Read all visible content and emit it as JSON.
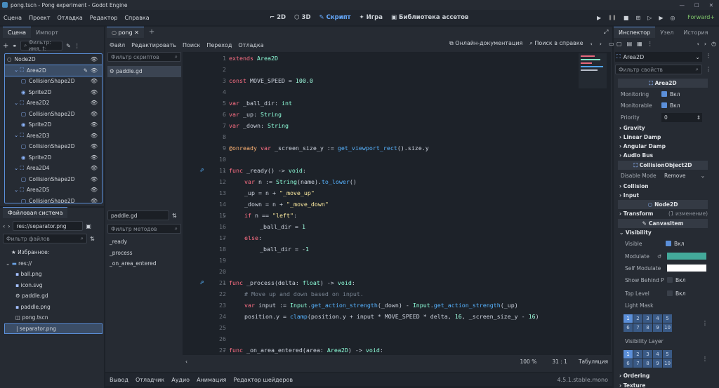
{
  "window": {
    "title": "pong.tscn - Pong experiment - Godot Engine"
  },
  "menu": {
    "items": [
      "Сцена",
      "Проект",
      "Отладка",
      "Редактор",
      "Справка"
    ],
    "workspaces": [
      "2D",
      "3D",
      "Скрипт",
      "Игра",
      "Библиотека ассетов"
    ],
    "renderer": "Forward+"
  },
  "scene_dock": {
    "tabs": [
      "Сцена",
      "Импорт"
    ],
    "filter_placeholder": "Фильтр: имя, t:",
    "tree": [
      {
        "name": "Node2D",
        "depth": 0
      },
      {
        "name": "Area2D",
        "depth": 1
      },
      {
        "name": "CollisionShape2D",
        "depth": 2
      },
      {
        "name": "Sprite2D",
        "depth": 2
      },
      {
        "name": "Area2D2",
        "depth": 1
      },
      {
        "name": "CollisionShape2D",
        "depth": 2
      },
      {
        "name": "Sprite2D",
        "depth": 2
      },
      {
        "name": "Area2D3",
        "depth": 1
      },
      {
        "name": "CollisionShape2D",
        "depth": 2
      },
      {
        "name": "Sprite2D",
        "depth": 2
      },
      {
        "name": "Area2D4",
        "depth": 1
      },
      {
        "name": "CollisionShape2D",
        "depth": 2
      },
      {
        "name": "Area2D5",
        "depth": 1
      },
      {
        "name": "CollisionShape2D",
        "depth": 2
      }
    ]
  },
  "filesystem": {
    "tab": "Файловая система",
    "path": "res://separator.png",
    "filter_placeholder": "Фильтр файлов",
    "favorites": "Избранное:",
    "root": "res://",
    "files": [
      "ball.png",
      "icon.svg",
      "paddle.gd",
      "paddle.png",
      "pong.tscn",
      "separator.png"
    ]
  },
  "editor": {
    "tab": "pong",
    "menu": [
      "Файл",
      "Редактировать",
      "Поиск",
      "Переход",
      "Отладка"
    ],
    "online_docs": "Онлайн-документация",
    "help_search": "Поиск в справке",
    "script_filter": "Фильтр скриптов",
    "open_script": "paddle.gd",
    "script_name": "paddle.gd",
    "method_filter": "Фильтр методов",
    "methods": [
      "_ready",
      "_process",
      "_on_area_entered"
    ],
    "lines": [
      "1",
      "2",
      "3",
      "4",
      "5",
      "6",
      "7",
      "8",
      "9",
      "10",
      "11",
      "12",
      "13",
      "14",
      "15",
      "16",
      "17",
      "18",
      "19",
      "20",
      "21",
      "22",
      "23",
      "24",
      "25",
      "26",
      "27"
    ],
    "code": [
      "extends Area2D",
      "",
      "const MOVE_SPEED = 100.0",
      "",
      "var _ball_dir: int",
      "var _up: String",
      "var _down: String",
      "",
      "@onready var _screen_size_y := get_viewport_rect().size.y",
      "",
      "func _ready() -> void:",
      "var n := String(name).to_lower()",
      "_up = n + \"_move_up\"",
      "_down = n + \"_move_down\"",
      "if n == \"left\":",
      "_ball_dir = 1",
      "else:",
      "_ball_dir = -1",
      "",
      "",
      "func _process(delta: float) -> void:",
      "# Move up and down based on input.",
      "var input := Input.get_action_strength(_down) - Input.get_action_strength(_up)",
      "position.y = clamp(position.y + input * MOVE_SPEED * delta, 16, _screen_size_y - 16)",
      "",
      "",
      "func _on_area_entered(area: Area2D) -> void:"
    ],
    "status": {
      "zoom": "100 %",
      "line": "31",
      "col": "1",
      "indent": "Табуляция"
    }
  },
  "bottom": {
    "tabs": [
      "Вывод",
      "Отладчик",
      "Аудио",
      "Анимация",
      "Редактор шейдеров"
    ],
    "version": "4.5.1.stable.mono"
  },
  "inspector": {
    "tabs": [
      "Инспектор",
      "Узел",
      "История"
    ],
    "node": "Area2D",
    "filter_placeholder": "Фильтр свойств",
    "class_header": "Area2D",
    "monitoring": {
      "label": "Monitoring",
      "value": "Вкл"
    },
    "monitorable": {
      "label": "Monitorable",
      "value": "Вкл"
    },
    "priority": {
      "label": "Priority",
      "value": "0"
    },
    "groups": [
      "Gravity",
      "Linear Damp",
      "Angular Damp",
      "Audio Bus"
    ],
    "collision_object": "CollisionObject2D",
    "disable_mode": {
      "label": "Disable Mode",
      "value": "Remove"
    },
    "groups2": [
      "Collision",
      "Input"
    ],
    "node2d": "Node2D",
    "transform": {
      "label": "Transform",
      "value": "(1 изменение)"
    },
    "canvas_item": "CanvasItem",
    "visibility": "Visibility",
    "visible": {
      "label": "Visible",
      "value": "Вкл"
    },
    "modulate": {
      "label": "Modulate",
      "color": "#43a99a"
    },
    "self_modulate": {
      "label": "Self Modulate",
      "color": "#ffffff"
    },
    "show_behind": {
      "label": "Show Behind P",
      "value": "Вкл"
    },
    "top_level": {
      "label": "Top Level",
      "value": "Вкл"
    },
    "light_mask": "Light Mask",
    "layers_row1": [
      "1",
      "2",
      "3",
      "4",
      "5"
    ],
    "layers_row2": [
      "6",
      "7",
      "8",
      "9",
      "10"
    ],
    "visibility_layer": "Visibility Layer",
    "ordering": "Ordering",
    "texture": "Texture"
  },
  "colors": {
    "accent": "#5b8fd9",
    "script_active": "#66aaff",
    "renderer": "#7ec46a"
  }
}
